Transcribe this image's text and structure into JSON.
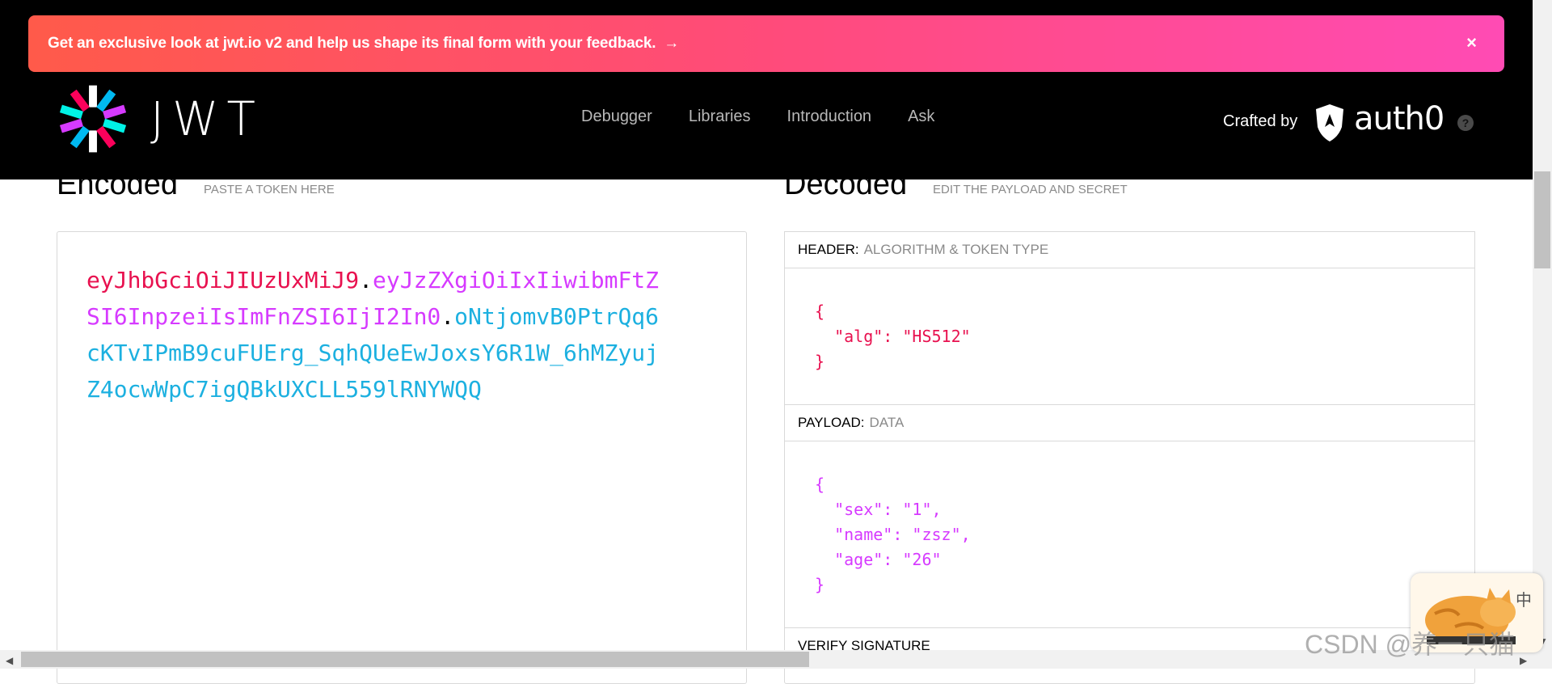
{
  "banner": {
    "text": "Get an exclusive look at jwt.io v2 and help us shape its final form with your feedback.",
    "arrow": "→",
    "close": "×"
  },
  "brand": {
    "logo_text": "JWT"
  },
  "nav": [
    "Debugger",
    "Libraries",
    "Introduction",
    "Ask"
  ],
  "crafted": {
    "label": "Crafted by",
    "brand": "auth0",
    "help": "?"
  },
  "encoded": {
    "title": "Encoded",
    "subtitle": "PASTE A TOKEN HERE",
    "token": {
      "header": "eyJhbGciOiJIUzUxMiJ9",
      "payload": "eyJzZXgiOiIxIiwibmFtZSI6InpzeiIsImFnZSI6IjI2In0",
      "signature": "oNtjomvB0PtrQq6cKTvIPmB9cuFUErg_SqhQUeEwJoxsY6R1W_6hMZyujZ4ocwWpC7igQBkUXCLL559lRNYWQQ",
      "dot": "."
    }
  },
  "decoded": {
    "title": "Decoded",
    "subtitle": "EDIT THE PAYLOAD AND SECRET",
    "header_label": "HEADER:",
    "header_sub": "ALGORITHM & TOKEN TYPE",
    "header_json": "{\n  \"alg\": \"HS512\"\n}",
    "payload_label": "PAYLOAD:",
    "payload_sub": "DATA",
    "payload_json": "{\n  \"sex\": \"1\",\n  \"name\": \"zsz\",\n  \"age\": \"26\"\n}",
    "verify_label": "VERIFY SIGNATURE"
  },
  "watermark": {
    "text": "CSDN @养一只猫"
  },
  "colors": {
    "header_token": "#e8114f",
    "payload_token": "#d63aff",
    "signature_token": "#1cb0e0",
    "banner_start": "#ff5a4a",
    "banner_end": "#ff4bb4"
  }
}
